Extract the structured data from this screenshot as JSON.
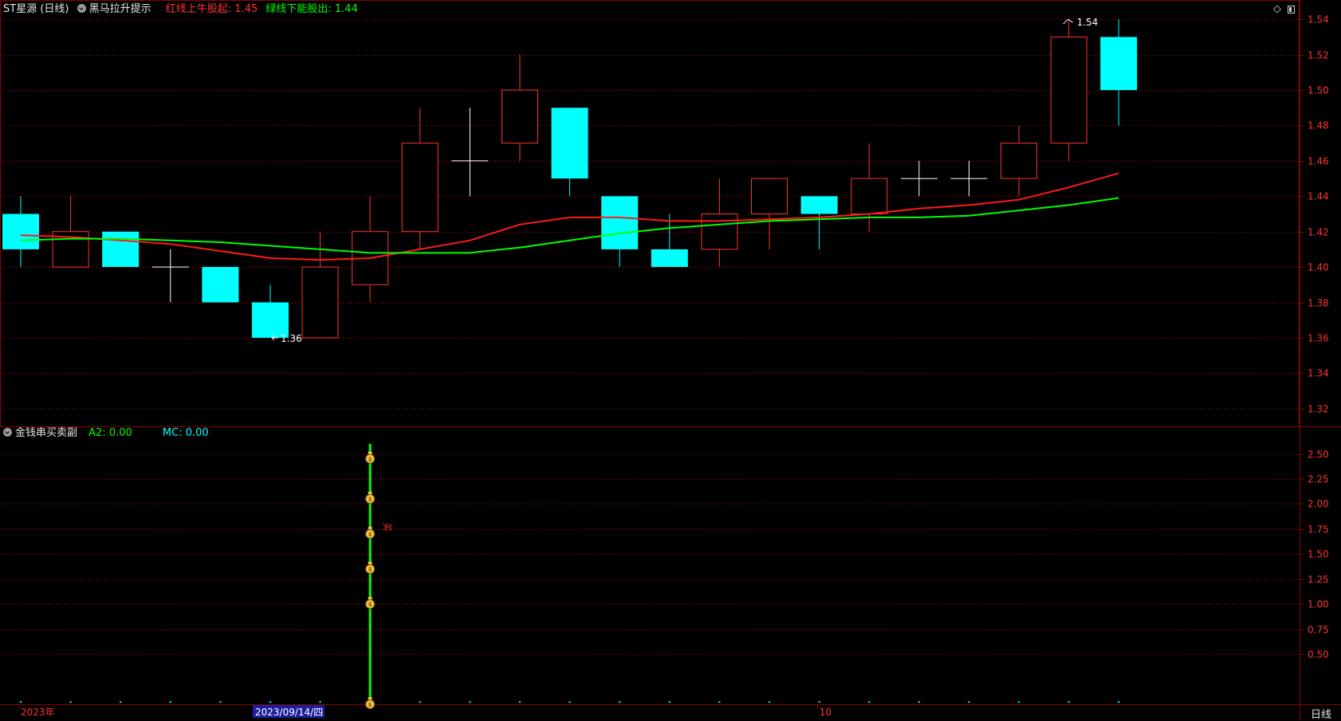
{
  "main_header": {
    "stock_label": "ST星源 (日线)",
    "indicator_name": "黑马拉升提示",
    "red_label": "红线上牛股起: 1.45",
    "green_label": "绿线下能股出: 1.44"
  },
  "sub_header": {
    "indicator_name": "金钱串买卖副",
    "a2_label": "A2: 0.00",
    "mc_label": "MC: 0.00"
  },
  "period_button": "日线",
  "colors": {
    "up": "#ff3232",
    "down": "#00ffff",
    "ma_red": "#ff1a1a",
    "ma_green": "#00ff00",
    "grid": "#8a0000",
    "axis_label": "#ff3232"
  },
  "chart_data": [
    {
      "type": "candlestick",
      "ylim": [
        1.31,
        1.55
      ],
      "yticks": [
        "1.32",
        "1.34",
        "1.36",
        "1.38",
        "1.40",
        "1.42",
        "1.44",
        "1.46",
        "1.48",
        "1.50",
        "1.52",
        "1.54"
      ],
      "candles": [
        {
          "o": 1.43,
          "h": 1.44,
          "l": 1.4,
          "c": 1.41
        },
        {
          "o": 1.4,
          "h": 1.44,
          "l": 1.4,
          "c": 1.42
        },
        {
          "o": 1.42,
          "h": 1.42,
          "l": 1.4,
          "c": 1.4
        },
        {
          "o": 1.4,
          "h": 1.41,
          "l": 1.38,
          "c": 1.4
        },
        {
          "o": 1.4,
          "h": 1.4,
          "l": 1.38,
          "c": 1.38
        },
        {
          "o": 1.38,
          "h": 1.39,
          "l": 1.36,
          "c": 1.36
        },
        {
          "o": 1.36,
          "h": 1.42,
          "l": 1.36,
          "c": 1.4
        },
        {
          "o": 1.39,
          "h": 1.44,
          "l": 1.38,
          "c": 1.42
        },
        {
          "o": 1.42,
          "h": 1.49,
          "l": 1.41,
          "c": 1.47
        },
        {
          "o": 1.46,
          "h": 1.49,
          "l": 1.44,
          "c": 1.46
        },
        {
          "o": 1.47,
          "h": 1.52,
          "l": 1.46,
          "c": 1.5
        },
        {
          "o": 1.49,
          "h": 1.49,
          "l": 1.44,
          "c": 1.45
        },
        {
          "o": 1.44,
          "h": 1.44,
          "l": 1.4,
          "c": 1.41
        },
        {
          "o": 1.41,
          "h": 1.43,
          "l": 1.4,
          "c": 1.4
        },
        {
          "o": 1.41,
          "h": 1.45,
          "l": 1.4,
          "c": 1.43
        },
        {
          "o": 1.43,
          "h": 1.45,
          "l": 1.41,
          "c": 1.45
        },
        {
          "o": 1.44,
          "h": 1.44,
          "l": 1.41,
          "c": 1.43
        },
        {
          "o": 1.43,
          "h": 1.47,
          "l": 1.42,
          "c": 1.45
        },
        {
          "o": 1.45,
          "h": 1.46,
          "l": 1.44,
          "c": 1.45
        },
        {
          "o": 1.45,
          "h": 1.46,
          "l": 1.44,
          "c": 1.45
        },
        {
          "o": 1.45,
          "h": 1.48,
          "l": 1.44,
          "c": 1.47
        },
        {
          "o": 1.47,
          "h": 1.54,
          "l": 1.46,
          "c": 1.53
        },
        {
          "o": 1.53,
          "h": 1.54,
          "l": 1.48,
          "c": 1.5
        }
      ],
      "series": [
        {
          "color": "red",
          "values": [
            1.418,
            1.417,
            1.415,
            1.413,
            1.409,
            1.405,
            1.404,
            1.405,
            1.41,
            1.415,
            1.424,
            1.428,
            1.428,
            1.426,
            1.426,
            1.427,
            1.428,
            1.43,
            1.433,
            1.435,
            1.438,
            1.445,
            1.453
          ]
        },
        {
          "color": "green",
          "values": [
            1.415,
            1.416,
            1.416,
            1.415,
            1.414,
            1.412,
            1.41,
            1.408,
            1.408,
            1.408,
            1.411,
            1.415,
            1.419,
            1.422,
            1.424,
            1.426,
            1.427,
            1.428,
            1.428,
            1.429,
            1.432,
            1.435,
            1.439
          ]
        }
      ],
      "annotations": [
        {
          "text": "1.54",
          "bar": 21,
          "y": 1.54,
          "kind": "high"
        },
        {
          "text": "1.36",
          "bar": 5,
          "y": 1.36,
          "kind": "low"
        }
      ]
    },
    {
      "type": "bar",
      "ylim": [
        0,
        2.6
      ],
      "yticks": [
        "0.50",
        "0.75",
        "1.00",
        "1.25",
        "1.50",
        "1.75",
        "2.00",
        "2.25",
        "2.50"
      ],
      "signal": {
        "bar": 7,
        "value": 2.6,
        "label": "买"
      },
      "coin_markers": [
        2.45,
        2.05,
        1.7,
        1.35,
        1.0,
        0.0
      ]
    }
  ],
  "x_axis": {
    "labels": [
      {
        "text": "2023年",
        "bar": 0,
        "highlight": false
      },
      {
        "text": "2023/09/14/四",
        "bar": 5,
        "highlight": true
      },
      {
        "text": "10",
        "bar": 16,
        "highlight": false
      }
    ]
  }
}
